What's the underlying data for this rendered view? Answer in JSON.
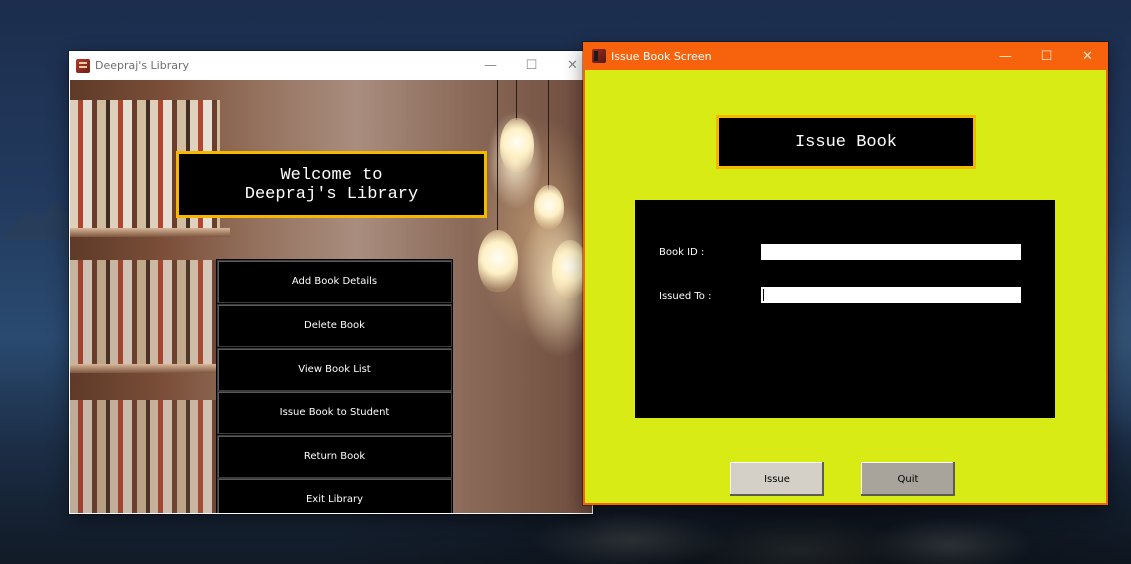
{
  "main_window": {
    "title": "Deepraj's Library",
    "controls": {
      "minimize": "—",
      "maximize": "☐",
      "close": "✕"
    },
    "welcome": {
      "line1": "Welcome to",
      "line2": "Deepraj's Library"
    },
    "menu": [
      "Add Book Details",
      "Delete Book",
      "View Book List",
      "Issue Book to Student",
      "Return Book",
      "Exit Library"
    ]
  },
  "issue_window": {
    "title": "Issue Book Screen",
    "controls": {
      "minimize": "—",
      "maximize": "☐",
      "close": "✕"
    },
    "heading": "Issue Book",
    "fields": {
      "book_id": {
        "label": "Book ID :",
        "value": ""
      },
      "issued_to": {
        "label": "Issued To :",
        "value": ""
      }
    },
    "buttons": {
      "issue": "Issue",
      "quit": "Quit"
    }
  },
  "colors": {
    "issue_titlebar": "#f7630c",
    "issue_background": "#d8eb14",
    "banner_border": "#f5b800"
  },
  "icons": {
    "app_icon": "book-icon"
  }
}
